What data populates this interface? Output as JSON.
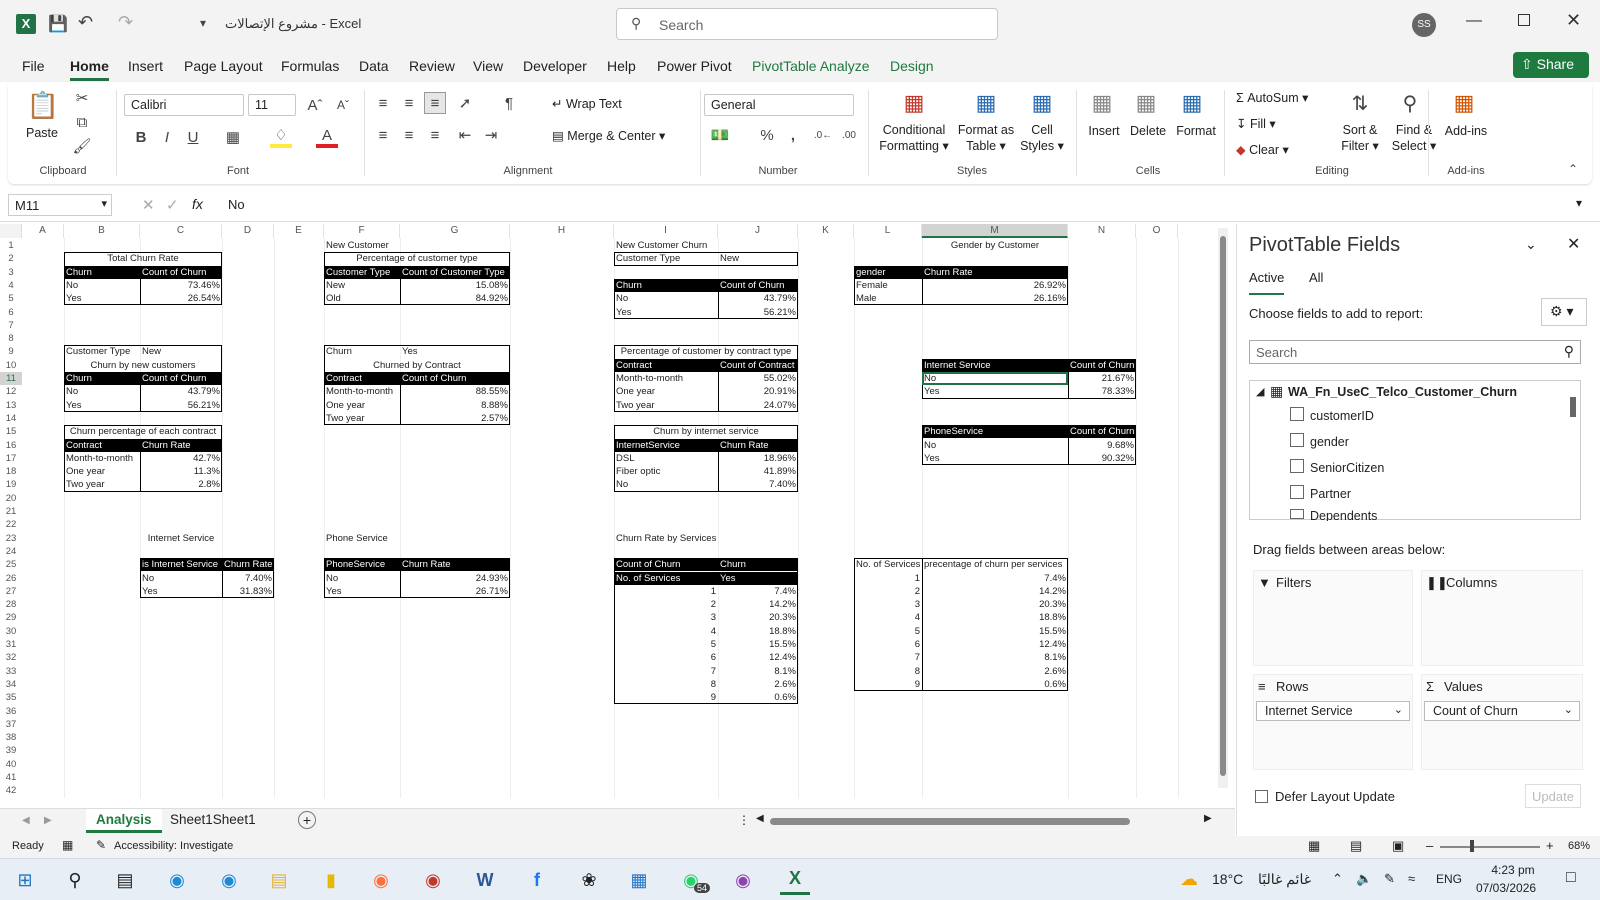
{
  "titlebar": {
    "title": "مشروع الإتصالات  -  Excel",
    "search_placeholder": "Search",
    "avatar": "SS"
  },
  "tabs": [
    "File",
    "Home",
    "Insert",
    "Page Layout",
    "Formulas",
    "Data",
    "Review",
    "View",
    "Developer",
    "Help",
    "Power Pivot",
    "PivotTable Analyze",
    "Design"
  ],
  "share_label": "Share",
  "ribbon": {
    "paste": "Paste",
    "font_name": "Calibri",
    "font_size": "11",
    "wrap_text": "Wrap Text",
    "merge_center": "Merge & Center",
    "number_format": "General",
    "conditional_formatting": [
      "Conditional",
      "Formatting"
    ],
    "format_as_table": [
      "Format as",
      "Table"
    ],
    "cell_styles": [
      "Cell",
      "Styles"
    ],
    "insert": "Insert",
    "delete": "Delete",
    "format": "Format",
    "autosum": "AutoSum",
    "fill": "Fill",
    "clear": "Clear",
    "sort_filter": [
      "Sort &",
      "Filter"
    ],
    "find_select": [
      "Find &",
      "Select"
    ],
    "addins": "Add-ins",
    "groups": [
      "Clipboard",
      "Font",
      "Alignment",
      "Number",
      "Styles",
      "Cells",
      "Editing",
      "Add-ins"
    ]
  },
  "formula_bar": {
    "name_box": "M11",
    "fx": "fx",
    "value": "No"
  },
  "columns": [
    "A",
    "B",
    "C",
    "D",
    "E",
    "F",
    "G",
    "H",
    "I",
    "J",
    "K",
    "L",
    "M",
    "N",
    "O"
  ],
  "rows": [
    "1",
    "2",
    "3",
    "4",
    "5",
    "6",
    "7",
    "8",
    "9",
    "10",
    "11",
    "12",
    "13",
    "14",
    "15",
    "16",
    "17",
    "18",
    "19",
    "20",
    "21",
    "22",
    "23",
    "24",
    "25",
    "26",
    "27",
    "28",
    "29",
    "30",
    "31",
    "32",
    "33",
    "34",
    "35",
    "36",
    "37",
    "38",
    "39",
    "40",
    "41",
    "42"
  ],
  "sheet": {
    "total_churn": {
      "title": "Total Churn Rate",
      "h1": "Churn",
      "h2": "Count of Churn",
      "rows": [
        [
          "No",
          "73.46%"
        ],
        [
          "Yes",
          "26.54%"
        ]
      ]
    },
    "new_customer": {
      "label": "New Customer",
      "title": "Percentage of customer type",
      "h1": "Customer Type",
      "h2": "Count of Customer Type",
      "rows": [
        [
          "New",
          "15.08%"
        ],
        [
          "Old",
          "84.92%"
        ]
      ]
    },
    "new_customer_churn": {
      "label": "New Customer Churn",
      "f1": "Customer Type",
      "f2": "New",
      "h1": "Churn",
      "h2": "Count of Churn",
      "rows": [
        [
          "No",
          "43.79%"
        ],
        [
          "Yes",
          "56.21%"
        ]
      ]
    },
    "gender": {
      "label": "Gender by Customer",
      "h1": "gender",
      "h2": "Churn Rate",
      "rows": [
        [
          "Female",
          "26.92%"
        ],
        [
          "Male",
          "26.16%"
        ]
      ]
    },
    "churn_new": {
      "f1": "Customer Type",
      "f2": "New",
      "title": "Churn by new customers",
      "h1": "Churn",
      "h2": "Count of Churn",
      "rows": [
        [
          "No",
          "43.79%"
        ],
        [
          "Yes",
          "56.21%"
        ]
      ]
    },
    "churned_contract": {
      "f1": "Churn",
      "f2": "Yes",
      "title": "Churned by  Contract",
      "h1": "Contract",
      "h2": "Count of Churn",
      "rows": [
        [
          "Month-to-month",
          "88.55%"
        ],
        [
          "One year",
          "8.88%"
        ],
        [
          "Two year",
          "2.57%"
        ]
      ]
    },
    "pct_contract": {
      "title": "Percentage of customer by contract type",
      "h1": "Contract",
      "h2": "Count of Contract",
      "rows": [
        [
          "Month-to-month",
          "55.02%"
        ],
        [
          "One year",
          "20.91%"
        ],
        [
          "Two year",
          "24.07%"
        ]
      ]
    },
    "internet_churn_pivot": {
      "h1": "Internet Service",
      "h2": "Count of Churn",
      "rows": [
        [
          "No",
          "21.67%"
        ],
        [
          "Yes",
          "78.33%"
        ]
      ]
    },
    "phone_churn_pivot": {
      "h1": "PhoneService",
      "h2": "Count of Churn",
      "rows": [
        [
          "No",
          "9.68%"
        ],
        [
          "Yes",
          "90.32%"
        ]
      ]
    },
    "churn_each_contract": {
      "title": "Churn percentage of each contract",
      "h1": "Contract",
      "h2": "Churn Rate",
      "rows": [
        [
          "Month-to-month",
          "42.7%"
        ],
        [
          "One year",
          "11.3%"
        ],
        [
          "Two year",
          "2.8%"
        ]
      ]
    },
    "churn_internet": {
      "title": "Churn by internet service",
      "h1": "InternetService",
      "h2": "Churn Rate",
      "rows": [
        [
          "DSL",
          "18.96%"
        ],
        [
          "Fiber optic",
          "41.89%"
        ],
        [
          "No",
          "7.40%"
        ]
      ]
    },
    "internet_service": {
      "label": "Internet Service",
      "h1": "is Internet Service",
      "h2": "Churn Rate",
      "rows": [
        [
          "No",
          "7.40%"
        ],
        [
          "Yes",
          "31.83%"
        ]
      ]
    },
    "phone_service": {
      "label": "Phone Service",
      "h1": "PhoneService",
      "h2": "Churn Rate",
      "rows": [
        [
          "No",
          "24.93%"
        ],
        [
          "Yes",
          "26.71%"
        ]
      ]
    },
    "churn_services": {
      "label": "Churn Rate by Services",
      "h1": "Count of Churn",
      "h2": "Churn",
      "h3": "No. of Services",
      "h4": "Yes",
      "rows": [
        [
          "1",
          "7.4%"
        ],
        [
          "2",
          "14.2%"
        ],
        [
          "3",
          "20.3%"
        ],
        [
          "4",
          "18.8%"
        ],
        [
          "5",
          "15.5%"
        ],
        [
          "6",
          "12.4%"
        ],
        [
          "7",
          "8.1%"
        ],
        [
          "8",
          "2.6%"
        ],
        [
          "9",
          "0.6%"
        ]
      ]
    },
    "services_table": {
      "h1": "No. of Services",
      "h2": "precentage of churn per services",
      "rows": [
        [
          "1",
          "7.4%"
        ],
        [
          "2",
          "14.2%"
        ],
        [
          "3",
          "20.3%"
        ],
        [
          "4",
          "18.8%"
        ],
        [
          "5",
          "15.5%"
        ],
        [
          "6",
          "12.4%"
        ],
        [
          "7",
          "8.1%"
        ],
        [
          "8",
          "2.6%"
        ],
        [
          "9",
          "0.6%"
        ]
      ]
    }
  },
  "sheet_tabs": [
    "Analysis",
    "Sheet1Sheet1"
  ],
  "pivot_panel": {
    "title": "PivotTable Fields",
    "tab_active": "Active",
    "tab_all": "All",
    "choose": "Choose fields to add to report:",
    "search_placeholder": "Search",
    "table_name": "WA_Fn_UseC_Telco_Customer_Churn",
    "fields": [
      "customerID",
      "gender",
      "SeniorCitizen",
      "Partner",
      "Dependents"
    ],
    "drag_label": "Drag fields between areas below:",
    "filters": "Filters",
    "columns": "Columns",
    "rows": "Rows",
    "values": "Values",
    "rows_field": "Internet Service",
    "values_field": "Count of Churn",
    "defer": "Defer Layout Update",
    "update": "Update"
  },
  "status": {
    "ready": "Ready",
    "accessibility": "Accessibility: Investigate",
    "zoom": "68%"
  },
  "taskbar": {
    "weather_temp": "18°C",
    "weather_text": "غائم غالبًا",
    "lang": "ENG",
    "time": "4:23 pm",
    "date": "07/03/2026",
    "badge": "54"
  },
  "colors": {
    "excel_green": "#217346",
    "accent_green": "#1f7a3f"
  }
}
